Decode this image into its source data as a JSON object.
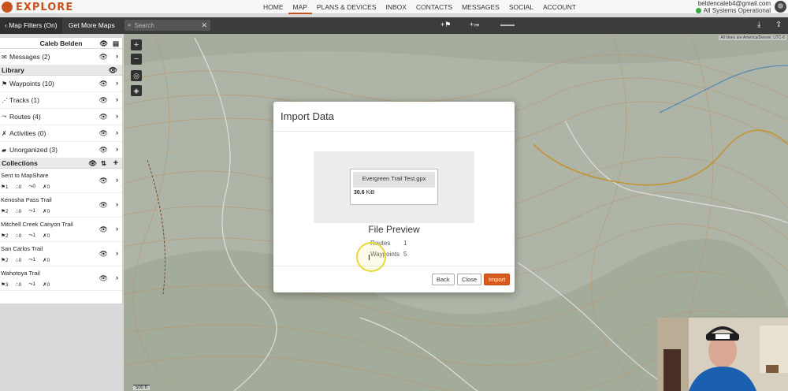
{
  "app": {
    "logo_text": "EXPLORE"
  },
  "nav": {
    "links": [
      "HOME",
      "MAP",
      "PLANS & DEVICES",
      "INBOX",
      "CONTACTS",
      "MESSAGES",
      "SOCIAL",
      "ACCOUNT"
    ],
    "active": "MAP"
  },
  "account": {
    "email": "beldencaleb4@gmail.com",
    "status": "All Systems Operational"
  },
  "toolbar": {
    "map_filters": "Map Filters (On)",
    "get_more_maps": "Get More Maps",
    "search_placeholder": "Search",
    "tool_add_waypoint": "+",
    "tool_add_route": "+"
  },
  "sidebar": {
    "user": "Caleb Belden",
    "messages": "Messages (2)",
    "library_title": "Library",
    "library_items": [
      "Waypoints (10)",
      "Tracks (1)",
      "Routes (4)",
      "Activities (0)",
      "Unorganized (3)"
    ],
    "collections_title": "Collections",
    "collections": [
      {
        "name": "Sent to MapShare",
        "stats": [
          "1",
          "0",
          "0",
          "0"
        ]
      },
      {
        "name": "Kenosha Pass Trail",
        "stats": [
          "2",
          "0",
          "1",
          "0"
        ]
      },
      {
        "name": "Mitchell Creek Canyon Trail",
        "stats": [
          "2",
          "0",
          "1",
          "0"
        ]
      },
      {
        "name": "San Carlos Trail",
        "stats": [
          "2",
          "0",
          "1",
          "0"
        ]
      },
      {
        "name": "Wahotoya Trail",
        "stats": [
          "3",
          "0",
          "1",
          "0"
        ]
      }
    ]
  },
  "map": {
    "scale": "500 ft",
    "attribution": "All times are America/Denver, UTC-6"
  },
  "modal": {
    "title": "Import Data",
    "file_name": "Evergreen Trail Test.gpx",
    "file_size_value": "30.6",
    "file_size_unit": "KiB",
    "preview_title": "File Preview",
    "rows": [
      {
        "label": "Routes",
        "value": "1"
      },
      {
        "label": "Waypoints",
        "value": "5"
      }
    ],
    "buttons": {
      "back": "Back",
      "close": "Close",
      "import": "Import"
    }
  },
  "colors": {
    "brand": "#c8531e",
    "toolbar": "#3c3c3c",
    "import_button": "#d95a1f",
    "status_ok": "#3aa53a"
  },
  "icons": [
    "logo-icon",
    "search-icon",
    "eye-icon",
    "chevron-right-icon",
    "flag-icon",
    "footprints-icon",
    "hiker-icon",
    "download-icon",
    "share-icon"
  ]
}
